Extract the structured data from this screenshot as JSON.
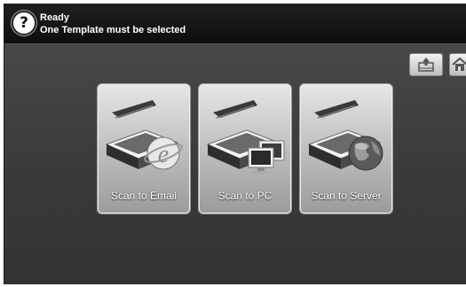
{
  "status": {
    "title": "Ready",
    "message": "One Template must be selected",
    "help_icon": "?"
  },
  "top_buttons": [
    {
      "name": "job-status-button",
      "icon": "tray-upload-icon"
    },
    {
      "name": "home-button",
      "icon": "home-icon"
    }
  ],
  "tiles": [
    {
      "label": "Scan to Email",
      "icon": "email-globe-icon"
    },
    {
      "label": "Scan to PC",
      "icon": "pc-monitors-icon"
    },
    {
      "label": "Scan to Server",
      "icon": "server-globe-icon"
    }
  ],
  "colors": {
    "background": "#3e3e3e",
    "statusbar": "#141414",
    "tile": "#c8c8c8"
  }
}
